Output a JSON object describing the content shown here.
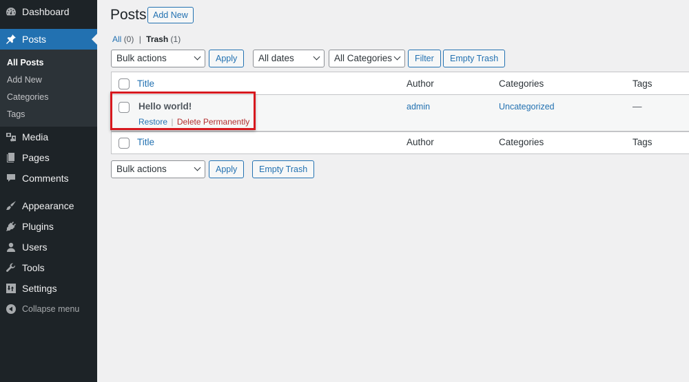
{
  "sidebar": {
    "items": [
      {
        "label": "Dashboard",
        "icon": "dashboard-icon"
      },
      {
        "label": "Posts",
        "icon": "pin-icon",
        "active": true
      },
      {
        "label": "Media",
        "icon": "media-icon"
      },
      {
        "label": "Pages",
        "icon": "pages-icon"
      },
      {
        "label": "Comments",
        "icon": "comments-icon"
      },
      {
        "label": "Appearance",
        "icon": "paintbrush-icon"
      },
      {
        "label": "Plugins",
        "icon": "plugin-icon"
      },
      {
        "label": "Users",
        "icon": "users-icon"
      },
      {
        "label": "Tools",
        "icon": "wrench-icon"
      },
      {
        "label": "Settings",
        "icon": "settings-icon"
      }
    ],
    "submenu": [
      {
        "label": "All Posts",
        "current": true
      },
      {
        "label": "Add New"
      },
      {
        "label": "Categories"
      },
      {
        "label": "Tags"
      }
    ],
    "collapse_label": "Collapse menu",
    "colors": {
      "background": "#1d2327",
      "active": "#2271b1",
      "submenu": "#2c3338"
    }
  },
  "header": {
    "title": "Posts",
    "add_new_label": "Add New"
  },
  "views": {
    "all_label": "All",
    "all_count": "(0)",
    "separator": "|",
    "trash_label": "Trash",
    "trash_count": "(1)"
  },
  "toolbar_top": {
    "bulk_actions": "Bulk actions",
    "apply_label": "Apply",
    "dates_filter": "All dates",
    "categories_filter": "All Categories",
    "filter_label": "Filter",
    "empty_trash_label": "Empty Trash"
  },
  "table": {
    "columns": [
      "Title",
      "Author",
      "Categories",
      "Tags"
    ],
    "rows": [
      {
        "title": "Hello world!",
        "author": "admin",
        "categories": "Uncategorized",
        "tags": "—",
        "actions": {
          "restore": "Restore",
          "separator": "|",
          "delete": "Delete Permanently"
        }
      }
    ]
  },
  "toolbar_bottom": {
    "bulk_actions": "Bulk actions",
    "apply_label": "Apply",
    "empty_trash_label": "Empty Trash"
  },
  "colors": {
    "accent": "#2271b1",
    "delete": "#b32d2e",
    "highlight": "#d7181e"
  }
}
